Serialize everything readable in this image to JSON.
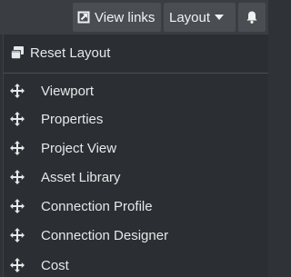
{
  "topbar": {
    "view_links_label": "View links",
    "layout_label": "Layout"
  },
  "menu": {
    "reset_label": "Reset Layout",
    "items": [
      {
        "label": "Viewport"
      },
      {
        "label": "Properties"
      },
      {
        "label": "Project View"
      },
      {
        "label": "Asset Library"
      },
      {
        "label": "Connection Profile"
      },
      {
        "label": "Connection Designer"
      },
      {
        "label": "Cost"
      }
    ]
  },
  "icons": {
    "view_links": "external-link-icon",
    "layout_caret": "caret-down-icon",
    "notifications": "bell-icon",
    "reset": "windows-stack-icon",
    "panel_item": "move-arrows-icon"
  },
  "colors": {
    "background": "#2f3236",
    "topbar": "#3a3d41",
    "button": "#4a4e53",
    "menu": "#2b2e32",
    "text": "#e6e8ea"
  }
}
